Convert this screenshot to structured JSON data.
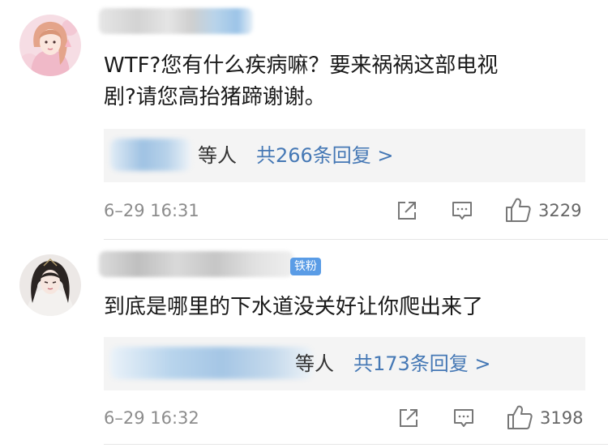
{
  "comments": [
    {
      "text_line1": "WTF?您有什么疾病嘛？要来祸祸这部电视",
      "text_line2": "剧?请您高抬猪蹄谢谢。",
      "reply_summary_suffix": "等人",
      "reply_link": "共266条回复 >",
      "timestamp": "6–29 16:31",
      "like_count": "3229",
      "icons": [
        "share-icon",
        "reply-icon",
        "like-icon"
      ]
    },
    {
      "badge": "铁粉",
      "text_line1": "到底是哪里的下水道没关好让你爬出来了",
      "reply_summary_suffix": "等人",
      "reply_link": "共173条回复 >",
      "timestamp": "6–29 16:32",
      "like_count": "3198",
      "icons": [
        "share-icon",
        "reply-icon",
        "like-icon"
      ]
    }
  ],
  "colors": {
    "link": "#4578b5",
    "badge": "#5a9ce6",
    "meta": "#8c8c8c",
    "reply_box": "#f4f4f4"
  }
}
